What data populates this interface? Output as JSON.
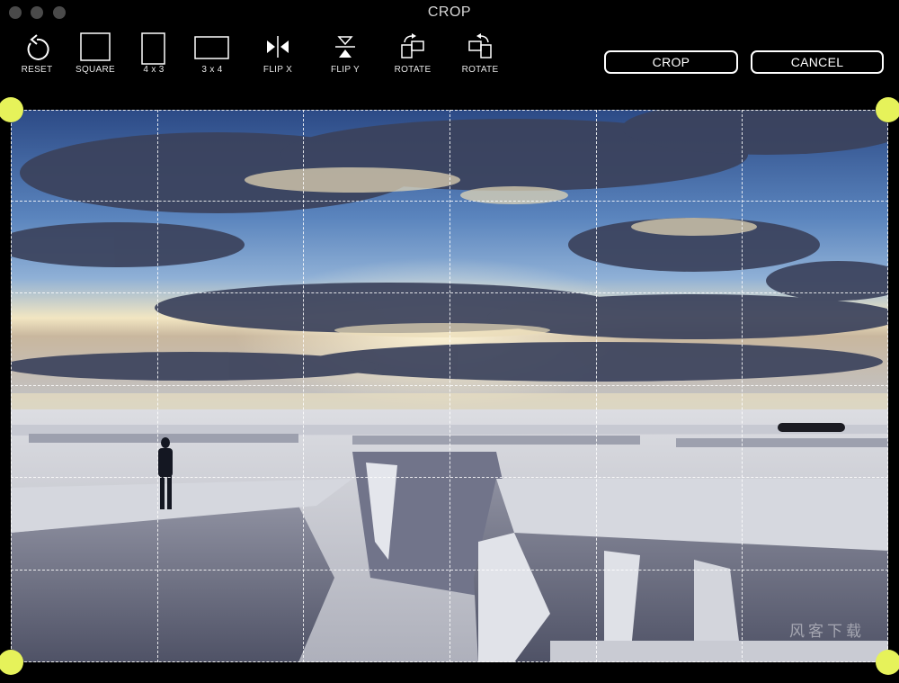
{
  "window": {
    "title": "CROP"
  },
  "toolbar": {
    "tools": [
      {
        "label": "RESET",
        "icon": "reset-icon"
      },
      {
        "label": "SQUARE",
        "icon": "square-icon"
      },
      {
        "label": "4 x 3",
        "icon": "portrait-rect-icon"
      },
      {
        "label": "3 x 4",
        "icon": "landscape-rect-icon"
      },
      {
        "label": "FLIP X",
        "icon": "flip-horizontal-icon"
      },
      {
        "label": "FLIP Y",
        "icon": "flip-vertical-icon"
      },
      {
        "label": "ROTATE",
        "icon": "rotate-right-icon"
      },
      {
        "label": "ROTATE",
        "icon": "rotate-left-icon"
      }
    ],
    "crop_label": "CROP",
    "cancel_label": "CANCEL"
  },
  "colors": {
    "background": "#000000",
    "handle": "#e6f25a",
    "button_border": "#ffffff"
  },
  "canvas": {
    "grid": "6 x 6 dashed grid",
    "watermark": "风客下载"
  }
}
